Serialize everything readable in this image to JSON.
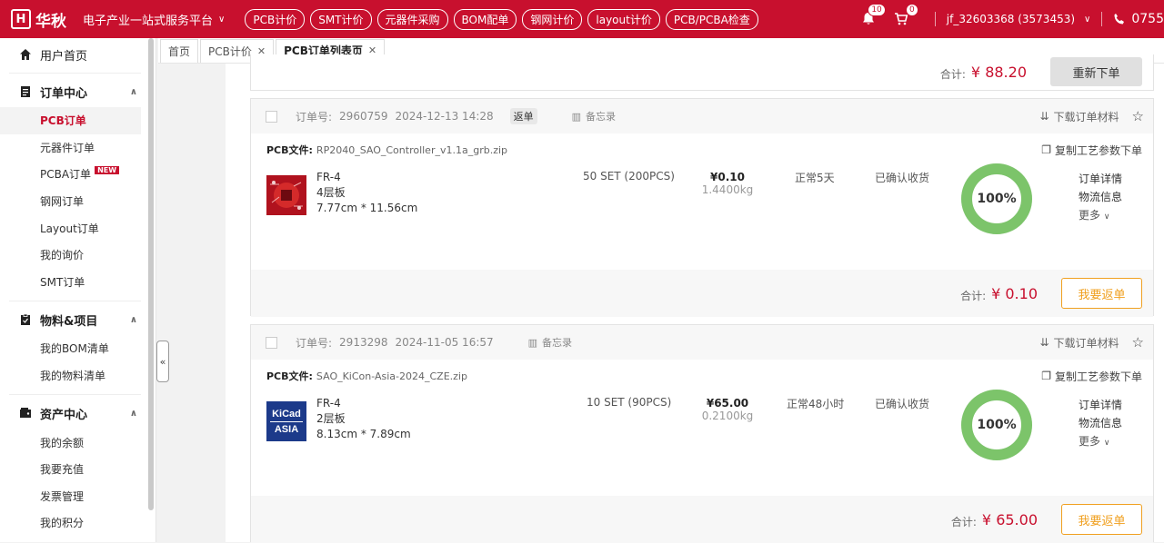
{
  "header": {
    "logo_mark": "H",
    "logo_text": "华秋",
    "platform": "电子产业一站式服务平台",
    "pills": [
      "PCB计价",
      "SMT计价",
      "元器件采购",
      "BOM配单",
      "钢网计价",
      "layout计价",
      "PCB/PCBA检查"
    ],
    "notify_count": "10",
    "cart_count": "0",
    "user": "jf_32603368 (3573453)",
    "phone": "0755"
  },
  "sidebar": {
    "home": "用户首页",
    "order_center": "订单中心",
    "orders": [
      "PCB订单",
      "元器件订单",
      "PCBA订单",
      "钢网订单",
      "Layout订单",
      "我的询价",
      "SMT订单"
    ],
    "new_tag": "NEW",
    "materials": "物料&项目",
    "material_items": [
      "我的BOM清单",
      "我的物料清单"
    ],
    "assets": "资产中心",
    "asset_items": [
      "我的余额",
      "我要充值",
      "发票管理",
      "我的积分"
    ]
  },
  "tabs": [
    "首页",
    "PCB计价",
    "PCB订单列表页"
  ],
  "prev_card": {
    "total_label": "合计:",
    "total": "¥ 88.20",
    "reorder": "重新下单"
  },
  "orders": [
    {
      "id_label": "订单号:",
      "id": "2960759",
      "date": "2024-12-13 14:28",
      "tag": "返单",
      "memo": "备忘录",
      "download": "下载订单材料",
      "file_label": "PCB文件:",
      "file": "RP2040_SAO_Controller_v1.1a_grb.zip",
      "copy": "复制工艺参数下单",
      "material": "FR-4",
      "layers": "4层板",
      "size": "7.77cm * 11.56cm",
      "qty": "50 SET (200PCS)",
      "price": "¥0.10",
      "weight": "1.4400kg",
      "lead": "正常5天",
      "status": "已确认收货",
      "progress": 100,
      "progress_text": "100%",
      "detail": "订单详情",
      "logistics": "物流信息",
      "more": "更多",
      "total_label": "合计:",
      "total": "¥ 0.10",
      "return_btn": "我要返单"
    },
    {
      "id_label": "订单号:",
      "id": "2913298",
      "date": "2024-11-05 16:57",
      "tag": "",
      "memo": "备忘录",
      "download": "下载订单材料",
      "file_label": "PCB文件:",
      "file": "SAO_KiCon-Asia-2024_CZE.zip",
      "copy": "复制工艺参数下单",
      "material": "FR-4",
      "layers": "2层板",
      "size": "8.13cm * 7.89cm",
      "qty": "10 SET (90PCS)",
      "price": "¥65.00",
      "weight": "0.2100kg",
      "lead": "正常48小时",
      "status": "已确认收货",
      "progress": 100,
      "progress_text": "100%",
      "detail": "订单详情",
      "logistics": "物流信息",
      "more": "更多",
      "total_label": "合计:",
      "total": "¥ 65.00",
      "return_btn": "我要返单",
      "thumb_text_1": "KiCad",
      "thumb_text_2": "ASIA"
    }
  ],
  "colors": {
    "brand": "#c8102e",
    "accent": "#f0a020",
    "progress": "#7cc46a"
  }
}
